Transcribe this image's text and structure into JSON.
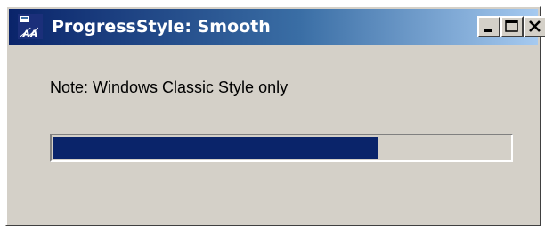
{
  "window": {
    "title": "ProgressStyle: Smooth",
    "app_icon": "vb-app-icon",
    "controls": {
      "minimize": "minimize-icon",
      "maximize": "maximize-icon",
      "close": "close-icon"
    }
  },
  "content": {
    "note": "Note: Windows Classic Style only"
  },
  "progress_bar": {
    "value_percent": 71,
    "fill_color": "#0a246a",
    "track_color": "#d4d0c8"
  },
  "colors": {
    "title_gradient_start": "#0a246a",
    "title_gradient_end": "#a6caf0",
    "face": "#d4d0c8"
  }
}
